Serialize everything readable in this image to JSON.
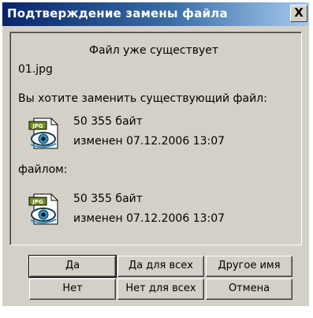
{
  "dialog": {
    "title": "Подтверждение замены файла",
    "close_label": "X"
  },
  "message": {
    "heading": "Файл уже существует",
    "filename": "01.jpg",
    "question": "Вы хотите заменить существующий файл:",
    "with_label": "файлом:"
  },
  "existing_file": {
    "icon": "jpg-file-icon",
    "size": "50 355 байт",
    "modified": "изменен 07.12.2006 13:07"
  },
  "new_file": {
    "icon": "jpg-file-icon",
    "size": "50 355 байт",
    "modified": "изменен 07.12.2006 13:07"
  },
  "buttons": {
    "yes": "Да",
    "yes_all": "Да для всех",
    "rename": "Другое имя",
    "no": "Нет",
    "no_all": "Нет для всех",
    "cancel": "Отмена"
  },
  "colors": {
    "dialog_bg": "#d4d0c8",
    "titlebar_start": "#0a246a",
    "titlebar_end": "#a6caf0",
    "icon_badge": "#7a9b1e"
  }
}
